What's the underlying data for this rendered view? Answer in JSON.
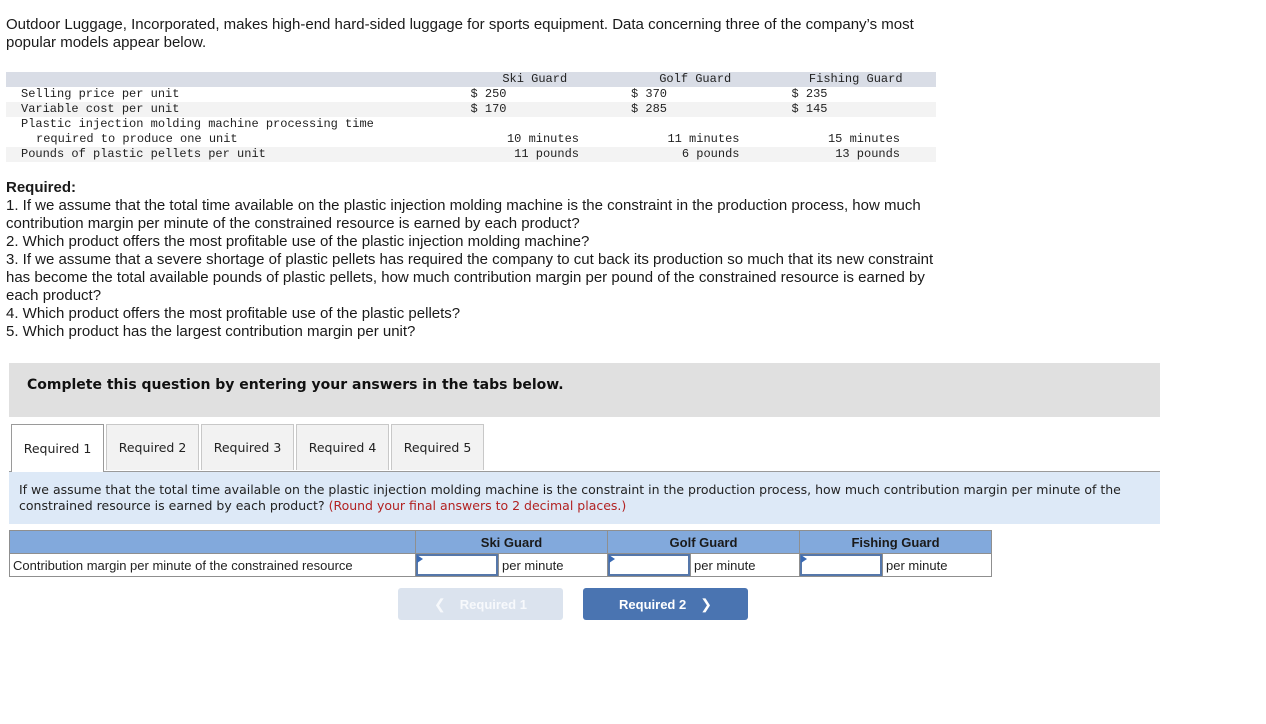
{
  "intro": "Outdoor Luggage, Incorporated, makes high-end hard-sided luggage for sports equipment. Data concerning three of the company’s most popular models appear below.",
  "data_table": {
    "columns": [
      "Ski Guard",
      "Golf Guard",
      "Fishing Guard"
    ],
    "rows": [
      {
        "label": "Selling price per unit",
        "values": [
          "$ 250",
          "$ 370",
          "$ 235"
        ]
      },
      {
        "label": "Variable cost per unit",
        "values": [
          "$ 170",
          "$ 285",
          "$ 145"
        ]
      },
      {
        "label": "Plastic injection molding machine processing time",
        "values": [
          "",
          "",
          ""
        ]
      },
      {
        "label": "required to produce one unit",
        "values": [
          "10 minutes",
          "11 minutes",
          "15 minutes"
        ]
      },
      {
        "label": "Pounds of plastic pellets per unit",
        "values": [
          "11 pounds",
          "6 pounds",
          "13 pounds"
        ]
      }
    ]
  },
  "required": {
    "title": "Required:",
    "items": [
      "1. If we assume that the total time available on the plastic injection molding machine is the constraint in the production process, how much contribution margin per minute of the constrained resource is earned by each product?",
      "2. Which product offers the most profitable use of the plastic injection molding machine?",
      "3. If we assume that a severe shortage of plastic pellets has required the company to cut back its production so much that its new constraint has become the total available pounds of plastic pellets, how much contribution margin per pound of the constrained resource is earned by each product?",
      "4. Which product offers the most profitable use of the plastic pellets?",
      "5. Which product has the largest contribution margin per unit?"
    ]
  },
  "banner": "Complete this question by entering your answers in the tabs below.",
  "tabs": [
    {
      "label": "Required 1",
      "active": true
    },
    {
      "label": "Required 2",
      "active": false
    },
    {
      "label": "Required 3",
      "active": false
    },
    {
      "label": "Required 4",
      "active": false
    },
    {
      "label": "Required 5",
      "active": false
    }
  ],
  "question": {
    "text": "If we assume that the total time available on the plastic injection molding machine is the constraint in the production process, how much contribution margin per minute of the constrained resource is earned by each product?",
    "hint": "(Round your final answers to 2 decimal places.)"
  },
  "answer_table": {
    "headers": [
      "Ski Guard",
      "Golf Guard",
      "Fishing Guard"
    ],
    "row_label": "Contribution margin per minute of the constrained resource",
    "values": [
      "",
      "",
      ""
    ],
    "unit": "per minute"
  },
  "nav": {
    "prev_label": "Required 1",
    "next_label": "Required 2",
    "prev_icon": "chevron-left-icon",
    "next_icon": "chevron-right-icon"
  }
}
